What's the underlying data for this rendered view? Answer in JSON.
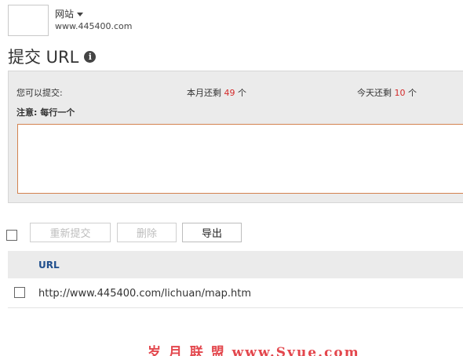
{
  "site": {
    "switch_label": "网站",
    "url": "www.445400.com"
  },
  "page": {
    "title": "提交 URL",
    "info_icon": "info-icon"
  },
  "quota": {
    "can_submit_label": "您可以提交:",
    "month_prefix": "本月还剩",
    "month_remaining": "49",
    "month_suffix": "个",
    "today_prefix": "今天还剩",
    "today_remaining": "10",
    "today_suffix": "个",
    "note": "注意: 每行一个",
    "input_value": ""
  },
  "toolbar": {
    "resubmit_label": "重新提交",
    "delete_label": "删除",
    "export_label": "导出"
  },
  "table": {
    "columns": [
      "URL"
    ],
    "rows": [
      {
        "url": "http://www.445400.com/lichuan/map.htm"
      }
    ]
  },
  "watermark": "岁 月 联 盟  www.Syue.com",
  "colors": {
    "accent_number": "#d42a2a",
    "header_link": "#1f4e8c",
    "input_border": "#d3824f",
    "watermark": "#e3474d"
  }
}
